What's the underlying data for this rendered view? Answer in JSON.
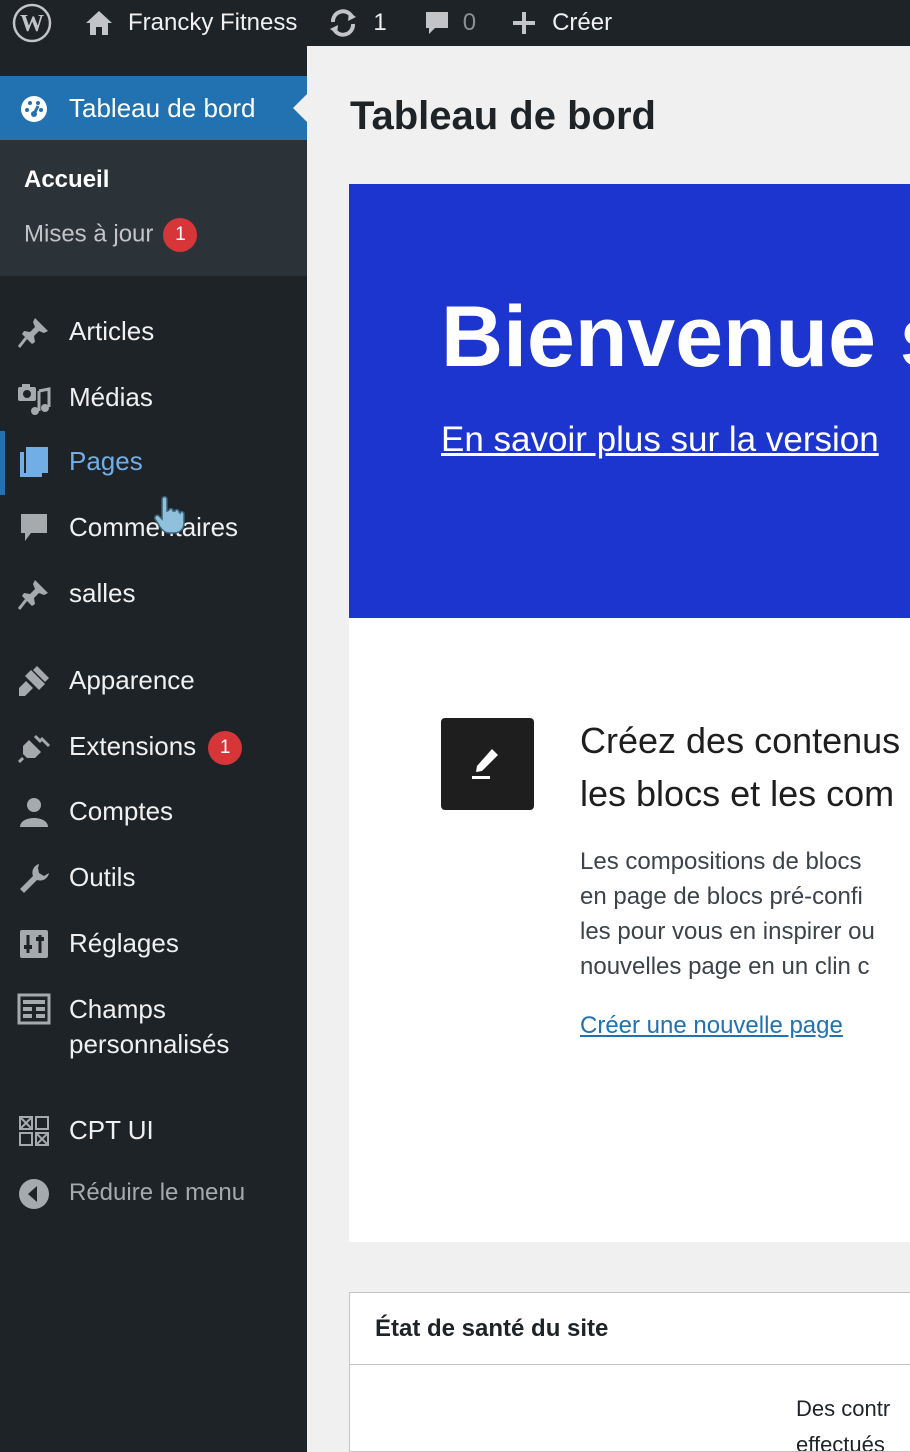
{
  "adminbar": {
    "logo_icon": "wordpress-icon",
    "site_name": "Francky Fitness",
    "updates_count": "1",
    "comments_count": "0",
    "new_label": "Créer"
  },
  "sidebar": {
    "current": {
      "label": "Tableau de bord",
      "icon": "dashboard-icon"
    },
    "submenu": [
      {
        "label": "Accueil"
      },
      {
        "label": "Mises à jour",
        "badge": "1"
      }
    ],
    "items": [
      {
        "label": "Articles",
        "icon": "pin-icon"
      },
      {
        "label": "Médias",
        "icon": "media-icon"
      },
      {
        "label": "Pages",
        "icon": "pages-icon"
      },
      {
        "label": "Commentaires",
        "icon": "comment-icon"
      },
      {
        "label": "salles",
        "icon": "pin-icon"
      },
      {
        "label": "Apparence",
        "icon": "brush-icon"
      },
      {
        "label": "Extensions",
        "icon": "plugin-icon",
        "badge": "1"
      },
      {
        "label": "Comptes",
        "icon": "user-icon"
      },
      {
        "label": "Outils",
        "icon": "wrench-icon"
      },
      {
        "label": "Réglages",
        "icon": "settings-icon"
      },
      {
        "label_line1": "Champs",
        "label_line2": "personnalisés",
        "icon": "fields-icon"
      },
      {
        "label": "CPT UI",
        "icon": "cpt-icon"
      },
      {
        "label": "Réduire le menu",
        "icon": "collapse-icon"
      }
    ]
  },
  "main": {
    "page_title": "Tableau de bord",
    "welcome": {
      "title": "Bienvenue s",
      "link": "En savoir plus sur la version"
    },
    "panel": {
      "icon": "edit-pencil-icon",
      "title_line1": "Créez des contenus",
      "title_line2": "les blocs et les com",
      "text_lines": [
        "Les compositions de blocs",
        "en page de blocs pré-confi",
        "les pour vous en inspirer ou",
        "nouvelles page en un clin c"
      ],
      "link": "Créer une nouvelle page"
    },
    "health": {
      "title": "État de santé du site",
      "text_line1": "Des contr",
      "text_line2": "effectués"
    }
  },
  "colors": {
    "adminbar_bg": "#1d2327",
    "menu_current_bg": "#2271b1",
    "welcome_bg": "#1d35cf",
    "badge": "#d63638",
    "link": "#2271b1"
  }
}
